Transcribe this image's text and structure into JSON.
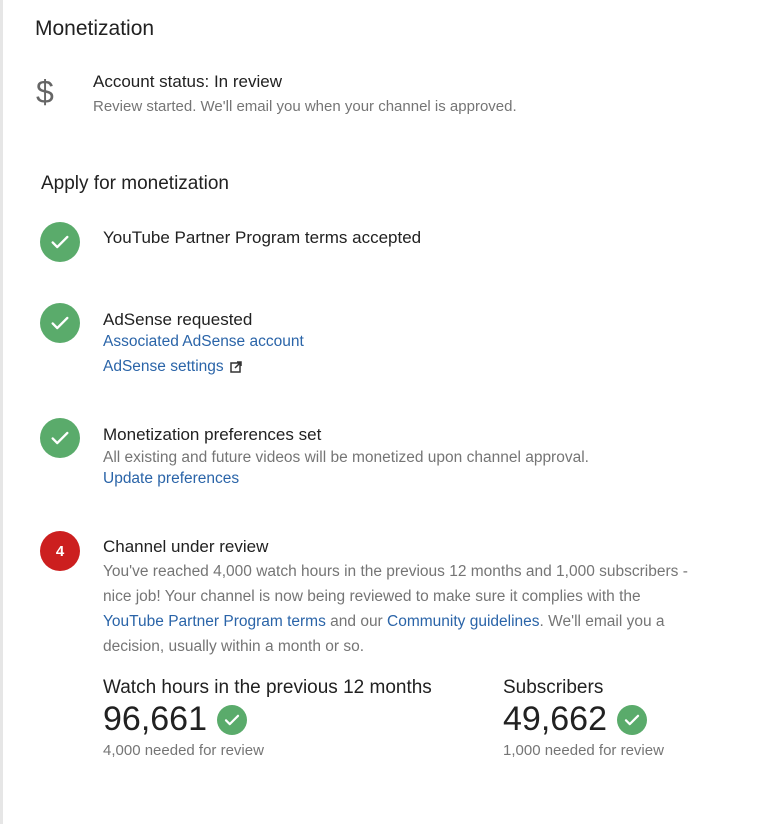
{
  "page_title": "Monetization",
  "account": {
    "icon": "dollar-icon",
    "status": "Account status: In review",
    "subtitle": "Review started. We'll email you when your channel is approved."
  },
  "apply": {
    "title": "Apply for monetization",
    "steps": [
      {
        "icon": "check-icon",
        "title": "YouTube Partner Program terms accepted"
      },
      {
        "icon": "check-icon",
        "title": "AdSense requested",
        "link1": "Associated AdSense account",
        "link2": "AdSense settings",
        "link2_icon": "external-link-icon"
      },
      {
        "icon": "check-icon",
        "title": "Monetization preferences set",
        "description": "All existing and future videos will be monetized upon channel approval.",
        "link": "Update preferences"
      },
      {
        "number": "4",
        "title": "Channel under review",
        "desc_part1": "You've reached 4,000 watch hours in the previous 12 months and 1,000 subscribers - nice job! Your channel is now being reviewed to make sure it complies with the ",
        "link_terms": "YouTube Partner Program terms",
        "desc_part2": " and our ",
        "link_guidelines": "Community guidelines",
        "desc_part3": ". We'll email you a decision, usually within a month or so."
      }
    ]
  },
  "stats": {
    "watch_hours": {
      "label": "Watch hours in the previous 12 months",
      "value": "96,661",
      "note": "4,000 needed for review"
    },
    "subscribers": {
      "label": "Subscribers",
      "value": "49,662",
      "note": "1,000 needed for review"
    }
  },
  "colors": {
    "check_green": "#5aab6b",
    "badge_red": "#cc1f1f",
    "link_blue": "#2a64a8"
  }
}
